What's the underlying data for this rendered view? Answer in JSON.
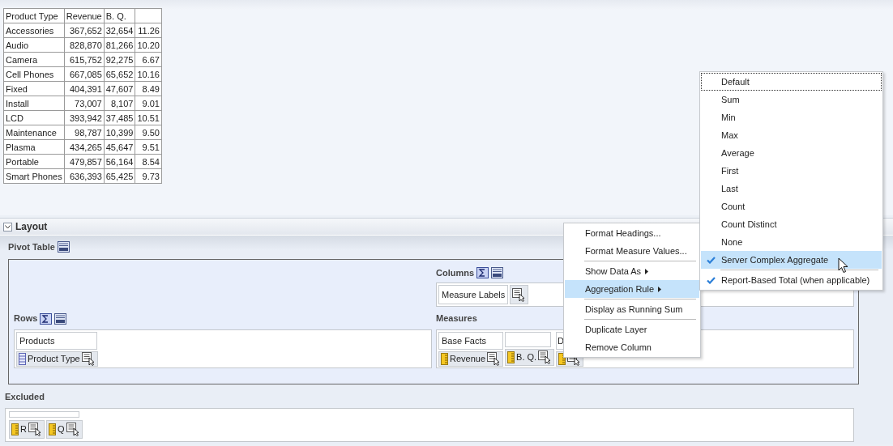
{
  "table": {
    "columns": [
      "Product Type",
      "Revenue",
      "B. Q."
    ],
    "rows": [
      [
        "Accessories",
        "367,652",
        "32,654",
        "11.26"
      ],
      [
        "Audio",
        "828,870",
        "81,266",
        "10.20"
      ],
      [
        "Camera",
        "615,752",
        "92,275",
        "6.67"
      ],
      [
        "Cell Phones",
        "667,085",
        "65,652",
        "10.16"
      ],
      [
        "Fixed",
        "404,391",
        "47,607",
        "8.49"
      ],
      [
        "Install",
        "73,007",
        "8,107",
        "9.01"
      ],
      [
        "LCD",
        "393,942",
        "37,485",
        "10.51"
      ],
      [
        "Maintenance",
        "98,787",
        "10,399",
        "9.50"
      ],
      [
        "Plasma",
        "434,265",
        "45,647",
        "9.51"
      ],
      [
        "Portable",
        "479,857",
        "56,164",
        "8.54"
      ],
      [
        "Smart Phones",
        "636,393",
        "65,425",
        "9.73"
      ]
    ]
  },
  "layout": {
    "title": "Layout",
    "expanded": true
  },
  "pivot": {
    "title": "Pivot Table",
    "columns": {
      "label": "Columns",
      "items": [
        {
          "label": "Measure Labels",
          "kind": "labels"
        }
      ]
    },
    "rows": {
      "label": "Rows",
      "items": [
        {
          "header": "Products",
          "label": "Product Type",
          "kind": "attribute"
        }
      ]
    },
    "measures": {
      "label": "Measures",
      "items": [
        {
          "header": "Base Facts",
          "label": "Revenue",
          "kind": "measure"
        },
        {
          "label": "B. Q.",
          "kind": "measure"
        },
        {
          "header": "D",
          "kind": "measure"
        }
      ]
    }
  },
  "excluded": {
    "label": "Excluded",
    "items": [
      {
        "label": "R",
        "kind": "measure"
      },
      {
        "label": "Q",
        "kind": "measure"
      }
    ]
  },
  "context_menu": [
    {
      "kind": "item",
      "label": "Format Headings...",
      "selected": false
    },
    {
      "kind": "item",
      "label": "Format Measure Values...",
      "selected": false
    },
    {
      "kind": "separator"
    },
    {
      "kind": "submenu",
      "label": "Show Data As",
      "selected": false
    },
    {
      "kind": "submenu",
      "label": "Aggregation Rule",
      "selected": true
    },
    {
      "kind": "separator"
    },
    {
      "kind": "item",
      "label": "Display as Running Sum",
      "selected": false
    },
    {
      "kind": "separator"
    },
    {
      "kind": "item",
      "label": "Duplicate Layer",
      "selected": false
    },
    {
      "kind": "item",
      "label": "Remove Column",
      "selected": false
    }
  ],
  "aggregation_menu": [
    {
      "kind": "item",
      "label": "Default",
      "checked": false,
      "selected": false,
      "focused": true
    },
    {
      "kind": "item",
      "label": "Sum",
      "checked": false,
      "selected": false,
      "focused": false
    },
    {
      "kind": "item",
      "label": "Min",
      "checked": false,
      "selected": false,
      "focused": false
    },
    {
      "kind": "item",
      "label": "Max",
      "checked": false,
      "selected": false,
      "focused": false
    },
    {
      "kind": "item",
      "label": "Average",
      "checked": false,
      "selected": false,
      "focused": false
    },
    {
      "kind": "item",
      "label": "First",
      "checked": false,
      "selected": false,
      "focused": false
    },
    {
      "kind": "item",
      "label": "Last",
      "checked": false,
      "selected": false,
      "focused": false
    },
    {
      "kind": "item",
      "label": "Count",
      "checked": false,
      "selected": false,
      "focused": false
    },
    {
      "kind": "item",
      "label": "Count Distinct",
      "checked": false,
      "selected": false,
      "focused": false
    },
    {
      "kind": "item",
      "label": "None",
      "checked": false,
      "selected": false,
      "focused": false
    },
    {
      "kind": "item",
      "label": "Server Complex Aggregate",
      "checked": true,
      "selected": true,
      "focused": false
    },
    {
      "kind": "separator"
    },
    {
      "kind": "item",
      "label": "Report-Based Total (when applicable)",
      "checked": true,
      "selected": false,
      "focused": false
    }
  ]
}
